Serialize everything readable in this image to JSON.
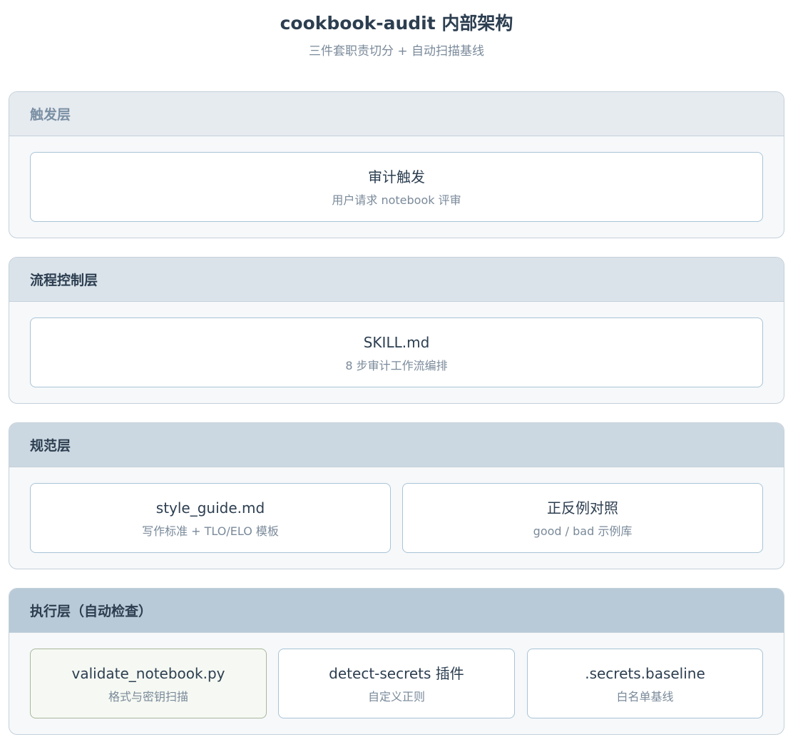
{
  "title": "cookbook-audit 内部架构",
  "subtitle": "三件套职责切分 + 自动扫描基线",
  "layers": [
    {
      "label": "触发层",
      "header_bg": "#e6ebf0",
      "header_color": "#7a8fa3",
      "nodes": [
        {
          "title": "审计触发",
          "sub": "用户请求 notebook 评审"
        }
      ]
    },
    {
      "label": "流程控制层",
      "header_bg": "#dae3ea",
      "header_color": "#2c3e50",
      "nodes": [
        {
          "title": "SKILL.md",
          "sub": "8 步审计工作流编排"
        }
      ]
    },
    {
      "label": "规范层",
      "header_bg": "#ccd8e1",
      "header_color": "#2c3e50",
      "nodes": [
        {
          "title": "style_guide.md",
          "sub": "写作标准 + TLO/ELO 模板"
        },
        {
          "title": "正反例对照",
          "sub": "good / bad 示例库"
        }
      ]
    },
    {
      "label": "执行层（自动检查）",
      "header_bg": "#b8cad7",
      "header_color": "#2c3e50",
      "nodes": [
        {
          "title": "validate_notebook.py",
          "sub": "格式与密钥扫描"
        },
        {
          "title": "detect-secrets 插件",
          "sub": "自定义正则"
        },
        {
          "title": ".secrets.baseline",
          "sub": "白名单基线"
        }
      ]
    }
  ]
}
